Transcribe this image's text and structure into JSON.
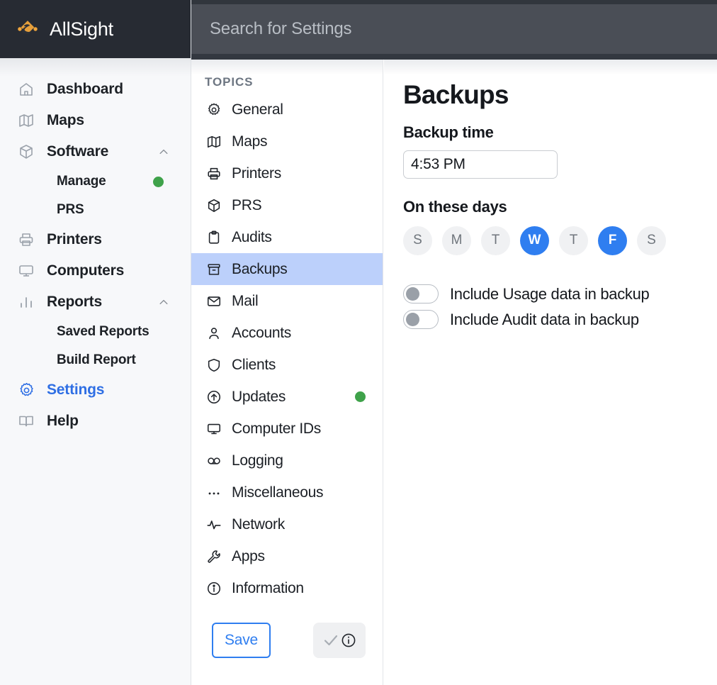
{
  "brand": {
    "name": "AllSight",
    "logo_icon": "allsight-diamond-logo",
    "accent_color": "#f0a53c"
  },
  "search": {
    "placeholder": "Search for Settings",
    "value": ""
  },
  "sidebar": {
    "items": [
      {
        "label": "Dashboard",
        "icon": "home-icon",
        "active": false,
        "expandable": false
      },
      {
        "label": "Maps",
        "icon": "map-icon",
        "active": false,
        "expandable": false
      },
      {
        "label": "Software",
        "icon": "box-icon",
        "active": false,
        "expandable": true,
        "expanded": true
      },
      {
        "label": "Printers",
        "icon": "printer-icon",
        "active": false,
        "expandable": false
      },
      {
        "label": "Computers",
        "icon": "monitor-icon",
        "active": false,
        "expandable": false
      },
      {
        "label": "Reports",
        "icon": "bar-chart-icon",
        "active": false,
        "expandable": true,
        "expanded": true
      },
      {
        "label": "Settings",
        "icon": "gear-icon",
        "active": true,
        "expandable": false
      },
      {
        "label": "Help",
        "icon": "book-icon",
        "active": false,
        "expandable": false
      }
    ],
    "software_children": [
      {
        "label": "Manage",
        "badge": "green-dot"
      },
      {
        "label": "PRS",
        "badge": null
      }
    ],
    "reports_children": [
      {
        "label": "Saved Reports",
        "badge": null
      },
      {
        "label": "Build Report",
        "badge": null
      }
    ],
    "badge_color": "#3fa24a"
  },
  "topics": {
    "heading": "TOPICS",
    "items": [
      {
        "label": "General",
        "icon": "gear-icon",
        "selected": false,
        "badge": null
      },
      {
        "label": "Maps",
        "icon": "map-icon",
        "selected": false,
        "badge": null
      },
      {
        "label": "Printers",
        "icon": "printer-icon",
        "selected": false,
        "badge": null
      },
      {
        "label": "PRS",
        "icon": "box-icon",
        "selected": false,
        "badge": null
      },
      {
        "label": "Audits",
        "icon": "clipboard-icon",
        "selected": false,
        "badge": null
      },
      {
        "label": "Backups",
        "icon": "archive-box-icon",
        "selected": true,
        "badge": null
      },
      {
        "label": "Mail",
        "icon": "envelope-icon",
        "selected": false,
        "badge": null
      },
      {
        "label": "Accounts",
        "icon": "person-icon",
        "selected": false,
        "badge": null
      },
      {
        "label": "Clients",
        "icon": "shield-icon",
        "selected": false,
        "badge": null
      },
      {
        "label": "Updates",
        "icon": "arrow-up-circle-icon",
        "selected": false,
        "badge": "green-dot"
      },
      {
        "label": "Computer IDs",
        "icon": "monitor-icon",
        "selected": false,
        "badge": null
      },
      {
        "label": "Logging",
        "icon": "reel-icon",
        "selected": false,
        "badge": null
      },
      {
        "label": "Miscellaneous",
        "icon": "ellipsis-icon",
        "selected": false,
        "badge": null
      },
      {
        "label": "Network",
        "icon": "activity-pulse-icon",
        "selected": false,
        "badge": null
      },
      {
        "label": "Apps",
        "icon": "wrench-icon",
        "selected": false,
        "badge": null
      },
      {
        "label": "Information",
        "icon": "info-circle-icon",
        "selected": false,
        "badge": null
      }
    ],
    "selected_color": "#bcd0fb",
    "save_label": "Save",
    "status_icons": [
      "check-icon",
      "info-circle-icon"
    ]
  },
  "main": {
    "title": "Backups",
    "backup_time_label": "Backup time",
    "backup_time_value": "4:53 PM",
    "days_label": "On these days",
    "days": [
      {
        "letter": "S",
        "name": "Sunday",
        "selected": false
      },
      {
        "letter": "M",
        "name": "Monday",
        "selected": false
      },
      {
        "letter": "T",
        "name": "Tuesday",
        "selected": false
      },
      {
        "letter": "W",
        "name": "Wednesday",
        "selected": true
      },
      {
        "letter": "T",
        "name": "Thursday",
        "selected": false
      },
      {
        "letter": "F",
        "name": "Friday",
        "selected": true
      },
      {
        "letter": "S",
        "name": "Saturday",
        "selected": false
      }
    ],
    "toggles": [
      {
        "label": "Include Usage data in backup",
        "on": false
      },
      {
        "label": "Include Audit data in backup",
        "on": false
      }
    ],
    "accent_color": "#2f7ef0"
  }
}
